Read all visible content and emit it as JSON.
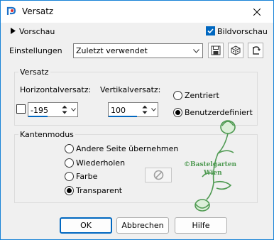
{
  "window": {
    "title": "Versatz"
  },
  "preview": {
    "label": "Vorschau",
    "image_preview_label": "Bildvorschau",
    "image_preview_checked": true
  },
  "settings": {
    "label": "Einstellungen",
    "value": "Zuletzt verwendet"
  },
  "offset": {
    "group_title": "Versatz",
    "horizontal_label": "Horizontalversatz:",
    "horizontal_value": "-195",
    "vertical_label": "Vertikalversatz:",
    "vertical_value": "100",
    "position_options": [
      {
        "label": "Zentriert",
        "selected": false
      },
      {
        "label": "Benutzerdefiniert",
        "selected": true
      }
    ]
  },
  "edge_mode": {
    "group_title": "Kantenmodus",
    "options": [
      {
        "label": "Andere Seite übernehmen",
        "selected": false
      },
      {
        "label": "Wiederholen",
        "selected": false
      },
      {
        "label": "Farbe",
        "selected": false
      },
      {
        "label": "Transparent",
        "selected": true
      }
    ]
  },
  "watermark": {
    "line1": "©Bastelgarten",
    "line2": "Wien"
  },
  "buttons": {
    "ok": "OK",
    "cancel": "Abbrechen",
    "help": "Hilfe"
  },
  "colors": {
    "accent": "#0067c0",
    "dialog_bg": "#f0f0f0",
    "watermark_green": "#4f9a52"
  }
}
